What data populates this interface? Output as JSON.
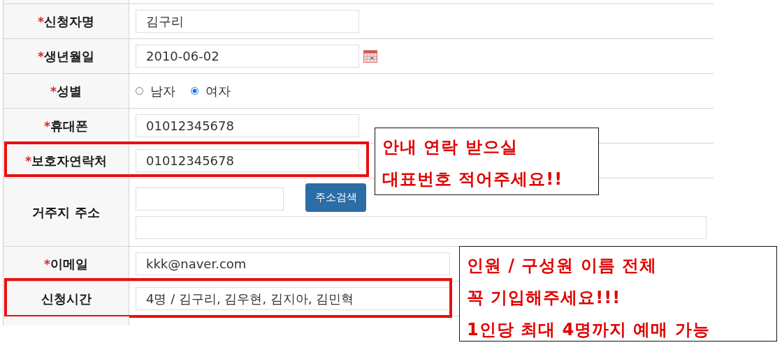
{
  "required_mark": "*",
  "rows": [
    {
      "label": "신청자명",
      "required": true,
      "kind": "text",
      "value": "김구리",
      "highlighted": false
    },
    {
      "label": "생년월일",
      "required": true,
      "kind": "date",
      "value": "2010-06-02",
      "highlighted": false
    },
    {
      "label": "성별",
      "required": true,
      "kind": "radio",
      "options": [
        {
          "label": "남자",
          "selected": false
        },
        {
          "label": "여자",
          "selected": true
        }
      ],
      "highlighted": false
    },
    {
      "label": "휴대폰",
      "required": true,
      "kind": "text",
      "value": "01012345678",
      "highlighted": false
    },
    {
      "label": "보호자연락처",
      "required": true,
      "kind": "text",
      "value": "01012345678",
      "highlighted": true
    },
    {
      "label": "거주지 주소",
      "required": false,
      "kind": "address",
      "button": "주소검색",
      "highlighted": false
    },
    {
      "label": "이메일",
      "required": true,
      "kind": "email",
      "value": "kkk@naver.com",
      "highlighted": false
    },
    {
      "label": "신청시간",
      "required": false,
      "kind": "people",
      "value": "4명 / 김구리, 김우현, 김지아, 김민혁",
      "highlighted": true
    }
  ],
  "callouts": [
    {
      "lines": [
        "안내 연락 받으실",
        "대표번호 적어주세요!!"
      ]
    },
    {
      "lines": [
        "인원 / 구성원 이름 전체",
        "꼭 기입해주세요!!!",
        "1인당 최대 4명까지 예매 가능"
      ]
    }
  ]
}
